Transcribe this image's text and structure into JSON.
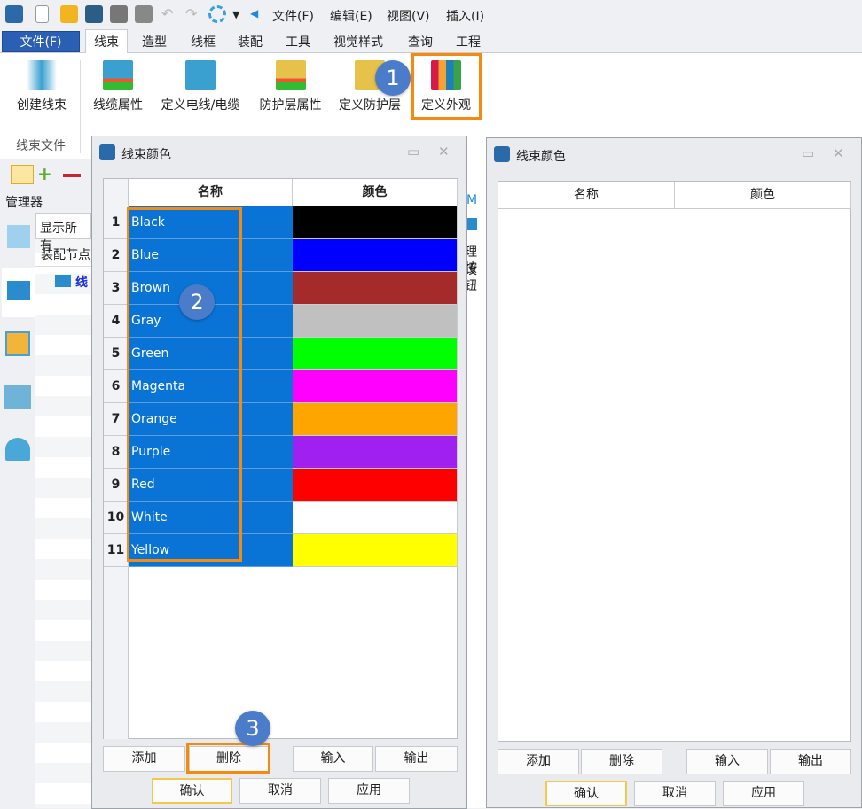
{
  "quick_access": {
    "icons": [
      "app-logo",
      "new-file",
      "open-folder",
      "save",
      "print",
      "print-preview",
      "undo",
      "redo",
      "refresh",
      "dropdown",
      "arrow-left"
    ],
    "menus": [
      "文件(F)",
      "编辑(E)",
      "视图(V)",
      "插入(I)"
    ]
  },
  "ribbon": {
    "file_button": "文件(F)",
    "tabs": [
      "线束",
      "造型",
      "线框",
      "装配",
      "工具",
      "视觉样式",
      "查询",
      "工程"
    ],
    "active_tab": "线束",
    "buttons": [
      "创建线束",
      "线缆属性",
      "定义电线/电缆",
      "防护层属性",
      "定义防护层",
      "定义外观"
    ],
    "group_label": "线束文件"
  },
  "manager": {
    "label": "管理器",
    "filter": "显示所有",
    "column": "装配节点",
    "tree_item": "线"
  },
  "background_fragments": [
    "M",
    "理设",
    "按钮"
  ],
  "badges": [
    "1",
    "2",
    "3"
  ],
  "dialog_left": {
    "title": "线束颜色",
    "columns": [
      "名称",
      "颜色"
    ],
    "rows": [
      {
        "n": "1",
        "name": "Black",
        "color": "#000000"
      },
      {
        "n": "2",
        "name": "Blue",
        "color": "#0000ff"
      },
      {
        "n": "3",
        "name": "Brown",
        "color": "#a52a2a"
      },
      {
        "n": "4",
        "name": "Gray",
        "color": "#c0c0c0"
      },
      {
        "n": "5",
        "name": "Green",
        "color": "#00ff00"
      },
      {
        "n": "6",
        "name": "Magenta",
        "color": "#ff00ff"
      },
      {
        "n": "7",
        "name": "Orange",
        "color": "#ffa500"
      },
      {
        "n": "8",
        "name": "Purple",
        "color": "#a020f0"
      },
      {
        "n": "9",
        "name": "Red",
        "color": "#ff0000"
      },
      {
        "n": "10",
        "name": "White",
        "color": "#ffffff"
      },
      {
        "n": "11",
        "name": "Yellow",
        "color": "#ffff00"
      }
    ],
    "buttons": {
      "add": "添加",
      "delete": "删除",
      "import": "输入",
      "export": "输出",
      "ok": "确认",
      "cancel": "取消",
      "apply": "应用"
    }
  },
  "dialog_right": {
    "title": "线束颜色",
    "columns": [
      "名称",
      "颜色"
    ],
    "rows": [],
    "buttons": {
      "add": "添加",
      "delete": "删除",
      "import": "输入",
      "export": "输出",
      "ok": "确认",
      "cancel": "取消",
      "apply": "应用"
    }
  },
  "colors": {
    "accent": "#2b5fb4",
    "selection": "#0a74d6",
    "highlight": "#f58a0f",
    "badge": "#4a7cc9"
  }
}
